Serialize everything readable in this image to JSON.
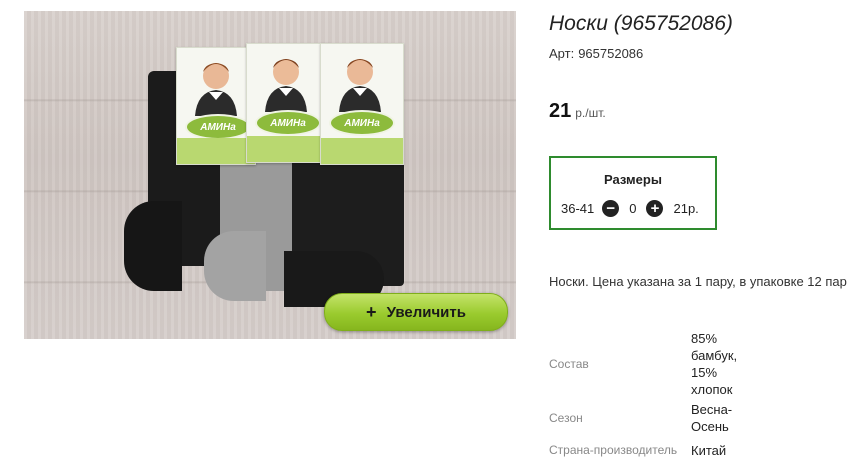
{
  "product": {
    "title": "Носки (965752086)",
    "sku_label": "Арт:",
    "sku_value": "965752086",
    "price_value": "21",
    "price_unit": "р./шт.",
    "zoom_button": "Увеличить",
    "zoom_icon": "+",
    "image_card_brand": "АМИНа",
    "description": "Носки. Цена указана за 1 пару, в упаковке 12 пар"
  },
  "sizes": {
    "title": "Размеры",
    "rows": [
      {
        "size": "36-41",
        "quantity": "0",
        "price": "21р."
      }
    ]
  },
  "properties": [
    {
      "key": "Состав",
      "value": "85% бамбук, 15% хлопок"
    },
    {
      "key": "Сезон",
      "value": "Весна-Осень"
    },
    {
      "key": "Страна-производитель",
      "value": "Китай"
    }
  ],
  "colors": {
    "accent_green": "#2e8b2e",
    "button_green": "#9acb2e"
  },
  "icons": [
    "zoom-plus-icon",
    "minus-circle-icon",
    "plus-circle-icon"
  ]
}
